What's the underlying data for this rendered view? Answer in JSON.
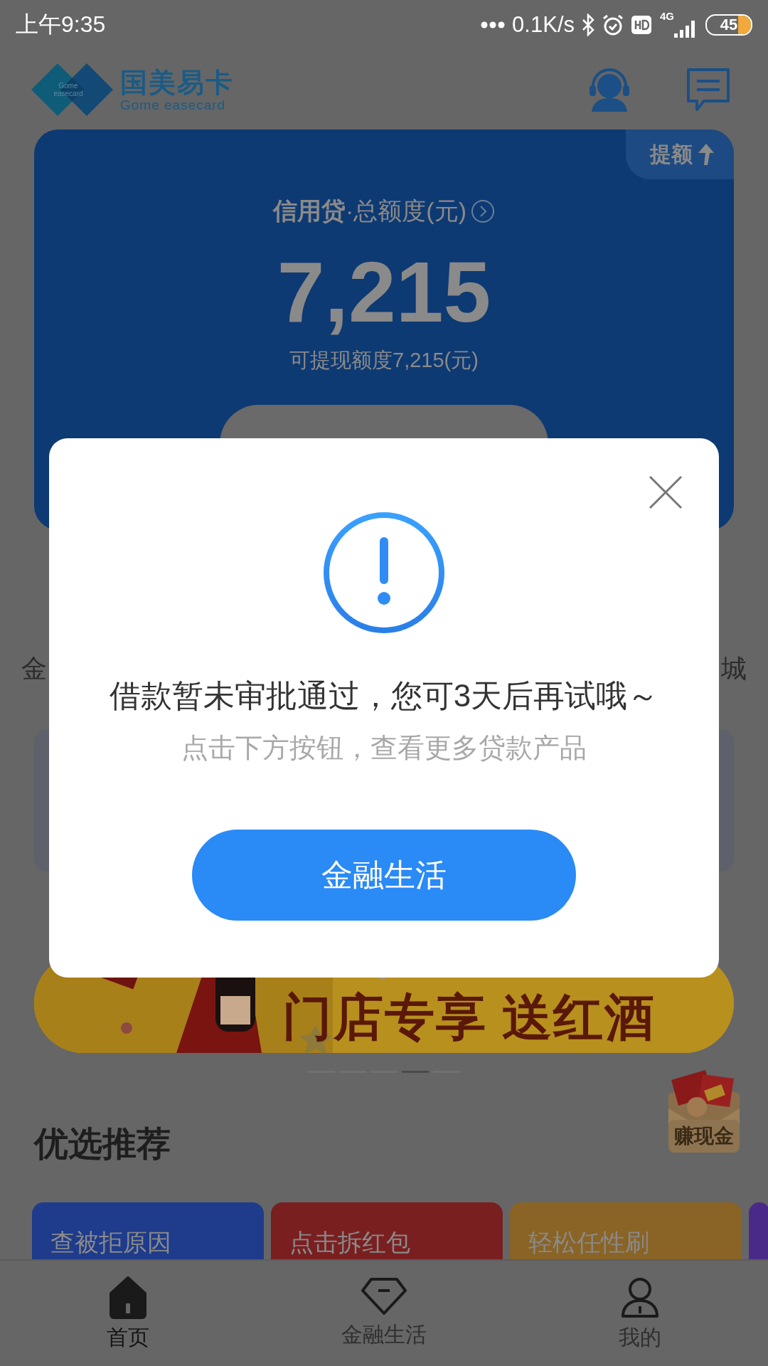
{
  "status_bar": {
    "time": "上午9:35",
    "net_speed": "0.1K/s",
    "network": "4G",
    "battery": "45"
  },
  "header": {
    "logo_badge": "Gome easecard",
    "logo_title": "国美易卡",
    "logo_subtitle": "Gome easecard"
  },
  "credit_card": {
    "raise_tag": "提额",
    "title": "**信用贷**·总额度(元)",
    "amount": "7,215",
    "available": "可提现额度7,215(元)"
  },
  "menu_row": {
    "edge_left": "金",
    "edge_right": "城"
  },
  "banner": {
    "text": "门店专享 送红酒"
  },
  "carousel_dots": [
    {
      "selected": false
    },
    {
      "selected": false
    },
    {
      "selected": false
    },
    {
      "selected": true
    },
    {
      "selected": false
    }
  ],
  "reward_badge": {
    "label": "赚现金"
  },
  "recommend": {
    "title": "优选推荐",
    "cards": [
      {
        "label": "查被拒原因",
        "color": "#1e3b8c"
      },
      {
        "label": "点击拆红包",
        "color": "#7a1f20"
      },
      {
        "label": "轻松任性刷",
        "color": "#8a6426"
      },
      {
        "color": "#4a2a88"
      }
    ]
  },
  "tab_bar": [
    {
      "label": "首页",
      "selected": true
    },
    {
      "label": "金融生活",
      "selected": false
    },
    {
      "label": "我的",
      "selected": false
    }
  ],
  "dialog": {
    "message": "借款暂未审批通过，您可3天后再试哦～",
    "hint": "点击下方按钮，查看更多贷款产品",
    "button": "金融生活"
  }
}
